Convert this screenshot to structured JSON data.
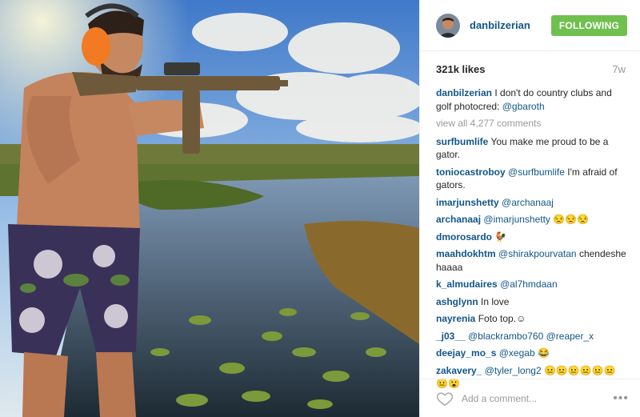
{
  "post": {
    "username": "danbilzerian",
    "follow_label": "FOLLOWING",
    "likes": "321k likes",
    "time_ago": "7w",
    "view_all": "view all 4,277 comments",
    "add_comment_placeholder": "Add a comment...",
    "more_glyph": "•••"
  },
  "caption": {
    "user": "danbilzerian",
    "text": "I don't do country clubs and golf photocred: ",
    "mention": "@gbaroth"
  },
  "comments": [
    {
      "user": "surfbumlife",
      "text": "You make me proud to be a gator.",
      "mention": ""
    },
    {
      "user": "toniocastroboy",
      "mention": "@surfbumlife",
      "text": "I'm afraid of gators."
    },
    {
      "user": "imarjunshetty",
      "mention": "@archanaaj",
      "text": ""
    },
    {
      "user": "archanaaj",
      "mention": "@imarjunshetty",
      "text": "😒😒😒"
    },
    {
      "user": "dmorosardo",
      "mention": "",
      "text": "🐓"
    },
    {
      "user": "maahdokhtm",
      "mention": "@shirakpourvatan",
      "text": "chendeshe haaaa"
    },
    {
      "user": "k_almudaires",
      "mention": "@al7hmdaan",
      "text": ""
    },
    {
      "user": "ashglynn",
      "mention": "",
      "text": "In love"
    },
    {
      "user": "nayrenia",
      "mention": "",
      "text": "Foto top.☺"
    },
    {
      "user": "_j03__",
      "mention": "@blackrambo760 @reaper_x",
      "text": ""
    },
    {
      "user": "deejay_mo_s",
      "mention": "@xegab",
      "text": "😂"
    },
    {
      "user": "zakavery_",
      "mention": "@tyler_long2",
      "text": "😐😐😐😐😐😐😐😮"
    }
  ],
  "colors": {
    "link": "#125688",
    "follow": "#70c050",
    "muted": "#999999"
  }
}
